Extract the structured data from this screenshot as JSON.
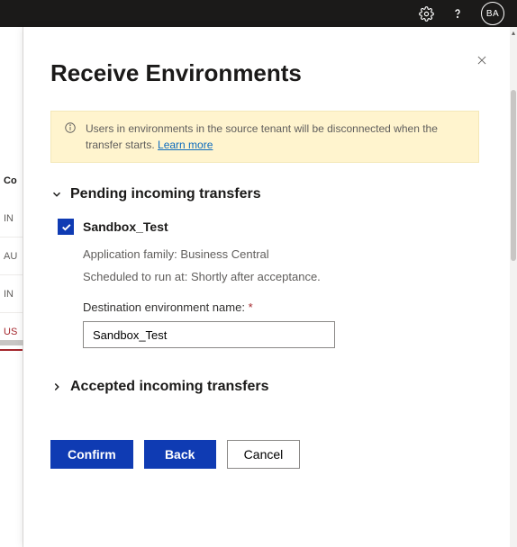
{
  "topbar": {
    "avatar_initials": "BA"
  },
  "bgnav": {
    "heading_fragment": "Co",
    "items": [
      "IN",
      "AU",
      "IN",
      "US"
    ]
  },
  "panel": {
    "title": "Receive Environments",
    "info": {
      "text": "Users in environments in the source tenant will be disconnected when the transfer starts.",
      "link_label": "Learn more"
    },
    "pending": {
      "heading": "Pending incoming transfers",
      "expanded": true,
      "transfer": {
        "checked": true,
        "name": "Sandbox_Test",
        "app_family_label": "Application family:",
        "app_family_value": "Business Central",
        "scheduled_label": "Scheduled to run at:",
        "scheduled_value": "Shortly after acceptance.",
        "dest_label": "Destination environment name:",
        "dest_required": "*",
        "dest_value": "Sandbox_Test"
      }
    },
    "accepted": {
      "heading": "Accepted incoming transfers",
      "expanded": false
    },
    "buttons": {
      "confirm": "Confirm",
      "back": "Back",
      "cancel": "Cancel"
    }
  }
}
